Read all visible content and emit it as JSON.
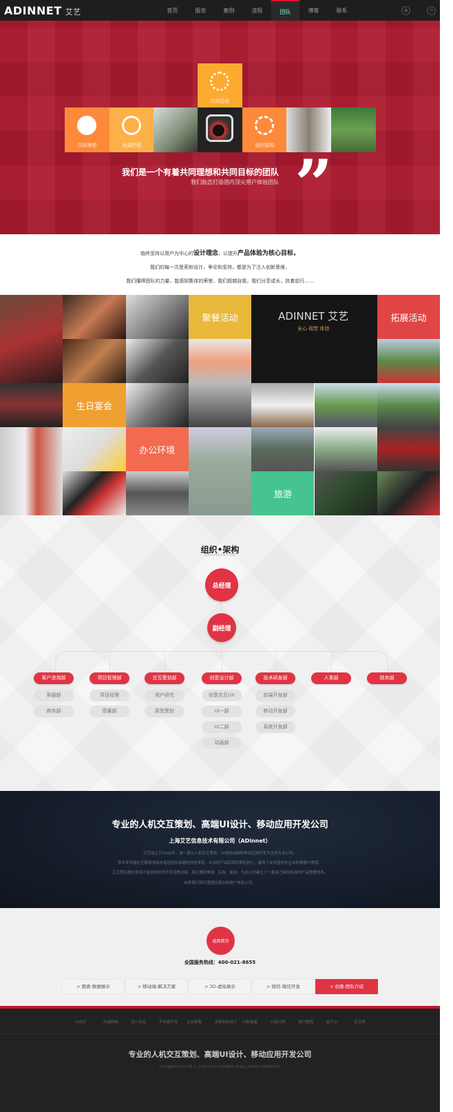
{
  "nav": {
    "logo": "ADINNET",
    "logo_cn": "艾艺",
    "items": [
      "首页",
      "服务",
      "案例",
      "流程",
      "团队",
      "博客",
      "联系"
    ],
    "active": 4,
    "social": [
      "weibo-icon",
      "wechat-icon"
    ]
  },
  "hero": {
    "tiles": {
      "goal": "共同目标",
      "ideal": "共同理想",
      "history": "发展历程",
      "org": "组织架构"
    },
    "headline": "我们是一个有着共同理想和共同目标的团队",
    "subline": "我们励志打造国内顶尖用户体验团队"
  },
  "intro": {
    "l1_a": "始终坚持以用户为中心的",
    "l1_b": "设计理念",
    "l1_c": "，以提升",
    "l1_d": "产品体验为核心目标，",
    "l2": "我们的每一次思索和设计，争论和坚持，都是为了注入创新思维，",
    "l3": "我们懂得团队的力量，能感知集体的荣誉，我们超越自我，我们分享成长，执着前行......"
  },
  "gallery": {
    "labels": [
      "聚餐活动",
      "拓展活动",
      "生日宴会",
      "办公环境",
      "旅游"
    ],
    "colors": [
      "#e8b93a",
      "#e04545",
      "#f0a030",
      "#f26a4f",
      "#45c48f"
    ],
    "sign": "ADINNET 艾艺",
    "sign_sub": "全心 视觉 体验"
  },
  "org": {
    "title": "组织•架构",
    "subtitle": "ORGANIZATION",
    "ceo": "总经理",
    "vp": "副经理",
    "departments": [
      {
        "name": "客户咨询部",
        "subs": [
          "客服部",
          "商务部"
        ]
      },
      {
        "name": "项目管理部",
        "subs": [
          "项目经理",
          "质量部"
        ]
      },
      {
        "name": "交互策划部",
        "subs": [
          "用户研究",
          "原型策划"
        ]
      },
      {
        "name": "创意设计部",
        "subs": [
          "创意交互UX",
          "UI一部",
          "UI二部",
          "动画部"
        ]
      },
      {
        "name": "技术研发部",
        "subs": [
          "前端开发部",
          "移动开发部",
          "系统开发部"
        ]
      },
      {
        "name": "人事部",
        "subs": []
      },
      {
        "name": "财务部",
        "subs": []
      }
    ]
  },
  "company": {
    "title": "专业的人机交互策划、高端UI设计、移动应用开发公司",
    "name": "上海艾艺信息技术有限公司（ADinnet）",
    "paragraphs": [
      "艾艺成立于2006年，是一家以人机交互策划、UI视觉动画和移动应用开发为主的专业公司。",
      "多年来凭借在互联网领域丰富经验和卓越的视觉表现，众多的产品和项目策划执行，赢得了众多国内外企业的拥泰与赞赏。",
      "艾艺团队擅长将设计呈现和技术开发完美对接，真正做到美观、实用、易用。为此公司建立了一套自己特色标准的产品管理体系。",
      "未来我们将打造国内顶尖的用户体验公司。"
    ]
  },
  "contact": {
    "home_button": "返回首页",
    "hotline_label": "全国服务热线：",
    "hotline": "400-021-8655",
    "links": [
      "图表-数据展示",
      "移动端-解决方案",
      "3D-虚拟展示",
      "微信-微信开发",
      "创意-团队介绍"
    ],
    "active_link": 4
  },
  "footer": {
    "links": [
      "UI设计",
      "天成网络",
      "设计名站",
      "手持端开发",
      "企业邮箱",
      "深圳商标设计",
      "UI制造者",
      "UI设计网",
      "设计教程",
      "盒子UI",
      "优艾网"
    ],
    "title": "专业的人机交互策划、高端UI设计、移动应用开发公司",
    "copyright": "沪ICP备05026071号 © 2006-2014 ADINNET.CN ALL RIGHTS RESERVED."
  },
  "colors": {
    "brand_red": "#e03444",
    "hero_red": "#af1b30",
    "nav_bg": "#1e1e1e"
  }
}
